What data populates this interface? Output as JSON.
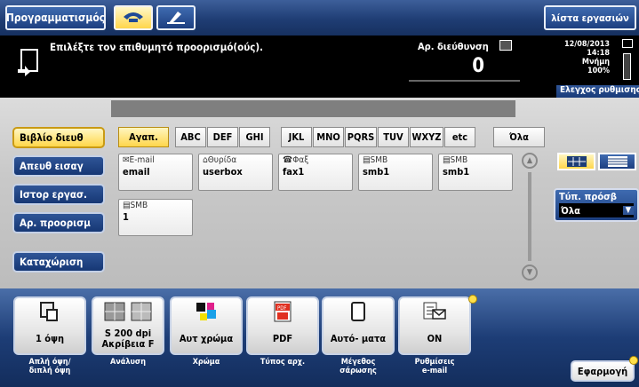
{
  "app": {
    "programming_label": "Προγραμματισμός",
    "job_list_label": "λίστα εργασιών"
  },
  "header": {
    "prompt": "Επιλέξτε τον επιθυμητό προορισμό(ούς).",
    "dest_count_label": "Αρ. διεύθυνση",
    "dest_count": "0",
    "date": "12/08/2013",
    "time": "14:18",
    "memory_label": "Μνήμη",
    "memory_value": "100%",
    "check_settings_label": "Ελεγχος ρυθμισης"
  },
  "sidebar": {
    "items": [
      {
        "label": "Βιβλίο διευθ",
        "active": true
      },
      {
        "label": "Απευθ εισαγ",
        "active": false
      },
      {
        "label": "Ιστορ εργασ.",
        "active": false
      },
      {
        "label": "Αρ. προορισμ",
        "active": false
      },
      {
        "label": "Καταχώριση",
        "active": false
      }
    ]
  },
  "index_tabs": [
    {
      "label": "Αγαπ.",
      "active": true
    },
    {
      "label": "ABC",
      "active": false
    },
    {
      "label": "DEF",
      "active": false
    },
    {
      "label": "GHI",
      "active": false
    },
    {
      "label": "JKL",
      "active": false
    },
    {
      "label": "MNO",
      "active": false
    },
    {
      "label": "PQRS",
      "active": false
    },
    {
      "label": "TUV",
      "active": false
    },
    {
      "label": "WXYZ",
      "active": false
    },
    {
      "label": "etc",
      "active": false
    },
    {
      "label": "Όλα",
      "active": false
    }
  ],
  "destinations": [
    {
      "type": "E-mail",
      "icon": "mail-icon",
      "name": "email"
    },
    {
      "type": "Θυρίδα",
      "icon": "userbox-icon",
      "name": "userbox"
    },
    {
      "type": "Φαξ",
      "icon": "fax-icon",
      "name": "fax1"
    },
    {
      "type": "SMB",
      "icon": "smb-icon",
      "name": "smb1"
    },
    {
      "type": "SMB",
      "icon": "smb-icon",
      "name": "smb1"
    },
    {
      "type": "SMB",
      "icon": "smb-icon",
      "name": "1"
    }
  ],
  "dest_type_filter": {
    "label": "Τύπ. πρόσβ",
    "value": "Όλα"
  },
  "functions": [
    {
      "label": "1 όψη",
      "caption": "Απλή όψη/\nδιπλή όψη",
      "icon": "simplex-icon"
    },
    {
      "label": "S 200 dpi\nΑκρίβεια F",
      "caption": "Ανάλυση",
      "icon": "resolution-icon"
    },
    {
      "label": "Αυτ χρώμα",
      "caption": "Χρώμα",
      "icon": "color-icon"
    },
    {
      "label": "PDF",
      "caption": "Τύπος αρχ.",
      "icon": "pdf-icon"
    },
    {
      "label": "Αυτό- ματα",
      "caption": "Μέγεθος\nσάρωσης",
      "icon": "document-icon"
    },
    {
      "label": "ON",
      "caption": "Ρυθμίσεις\ne-mail",
      "icon": "email-settings-icon"
    }
  ],
  "apply_label": "Εφαρμογή",
  "colors": {
    "accent": "#ffd74a",
    "header_bg": "#000000",
    "nav_blue": "#1d3d76"
  }
}
